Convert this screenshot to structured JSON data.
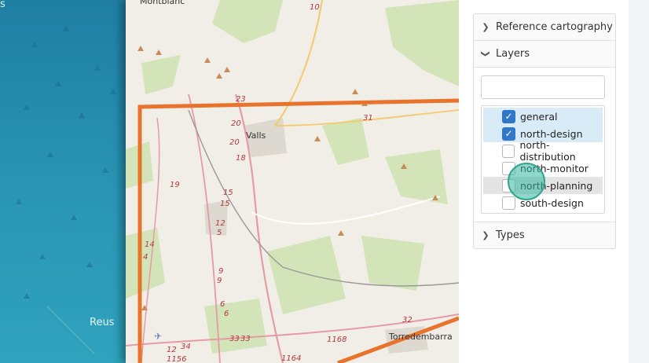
{
  "left_background": {
    "labels": [
      "s",
      "Reus"
    ]
  },
  "map": {
    "place_labels": [
      "Montblanc",
      "Valls",
      "Torredembarra"
    ],
    "road_labels": [
      "10",
      "23",
      "20",
      "20",
      "18",
      "19",
      "15",
      "15",
      "12",
      "5",
      "14",
      "4",
      "9",
      "9",
      "6",
      "6",
      "33",
      "33",
      "31",
      "32",
      "1168",
      "1164",
      "1156",
      "34",
      "12"
    ]
  },
  "panel": {
    "sections": {
      "reference": {
        "label": "Reference cartography",
        "expanded": false
      },
      "layers": {
        "label": "Layers",
        "expanded": true,
        "search_value": "",
        "items": [
          {
            "label": "general",
            "checked": true,
            "state": "selected"
          },
          {
            "label": "north-design",
            "checked": true,
            "state": "selected"
          },
          {
            "label": "north-distribution",
            "checked": false,
            "state": ""
          },
          {
            "label": "north-monitor",
            "checked": false,
            "state": ""
          },
          {
            "label": "north-planning",
            "checked": false,
            "state": "hover"
          },
          {
            "label": "south-design",
            "checked": false,
            "state": ""
          }
        ]
      },
      "types": {
        "label": "Types",
        "expanded": false
      }
    }
  },
  "icons": {
    "collapsed": "chevron-right-icon",
    "expanded": "chevron-down-icon",
    "check": "check-icon"
  },
  "colors": {
    "boundary": "#e8732c",
    "checkbox": "#2f77c9",
    "selection": "#d9ebf7",
    "cursor": "#34b7a0"
  }
}
